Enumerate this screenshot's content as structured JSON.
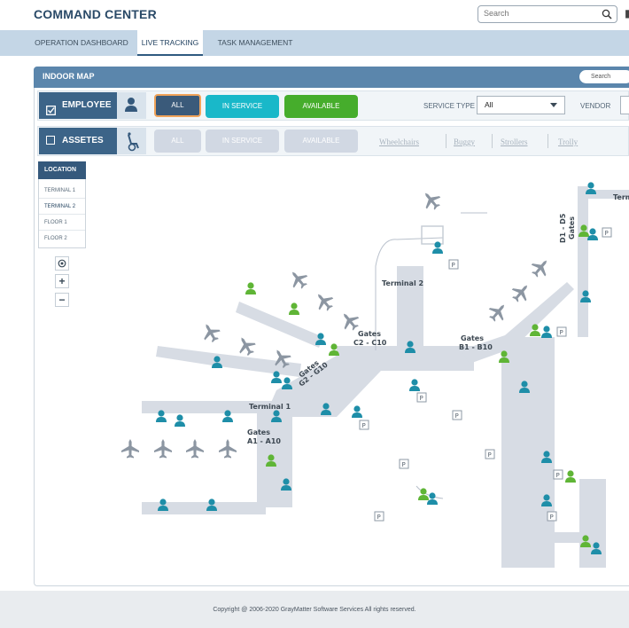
{
  "app": {
    "title": "COMMAND CENTER"
  },
  "search": {
    "placeholder": "Search"
  },
  "nav": {
    "tabs": [
      "OPERATION DASHBOARD",
      "LIVE TRACKING",
      "TASK MANAGEMENT"
    ],
    "active": "LIVE TRACKING"
  },
  "panel": {
    "title": "INDOOR MAP",
    "search_placeholder": "Search"
  },
  "filters": {
    "employee": {
      "label": "EMPLOYEE",
      "checked": true,
      "buttons": [
        "ALL",
        "IN SERVICE",
        "AVAILABLE"
      ],
      "selected": "ALL"
    },
    "assets": {
      "label": "ASSETES",
      "checked": false,
      "buttons": [
        "ALL",
        "IN SERVICE",
        "AVAILABLE"
      ],
      "types": [
        "Wheelchairs",
        "Buggy",
        "Strollers",
        "Trolly"
      ]
    },
    "service_type": {
      "label": "SERVICE TYPE",
      "value": "All"
    },
    "vendor": {
      "label": "VENDOR"
    }
  },
  "location": {
    "title": "LOCATION",
    "items": [
      "TERMINAL 1",
      "TERMINAL 2",
      "FLOOR 1",
      "FLOOR 2"
    ],
    "selected": "TERMINAL 2"
  },
  "map": {
    "labels": {
      "terminal1": "Terminal 1",
      "terminal2": "Terminal 2",
      "terminal_cut": "Term",
      "gates_a": [
        "Gates",
        "A1 - A10"
      ],
      "gates_b": [
        "Gates",
        "B1 - B10"
      ],
      "gates_c": [
        "Gates",
        "C2 - C10"
      ],
      "gates_g": [
        "Gates",
        "G2 - G10"
      ],
      "gates_d": [
        "Gates",
        "D1 - D5"
      ],
      "parking": "P"
    },
    "colors": {
      "in_service": "#1e8ea8",
      "available": "#5fb536",
      "terminal_fill": "#d7dce4",
      "aircraft": "#8c96a2"
    }
  },
  "footer": {
    "copyright": "Copyright @ 2006-2020  GrayMatter Software Services  All rights reserved."
  }
}
